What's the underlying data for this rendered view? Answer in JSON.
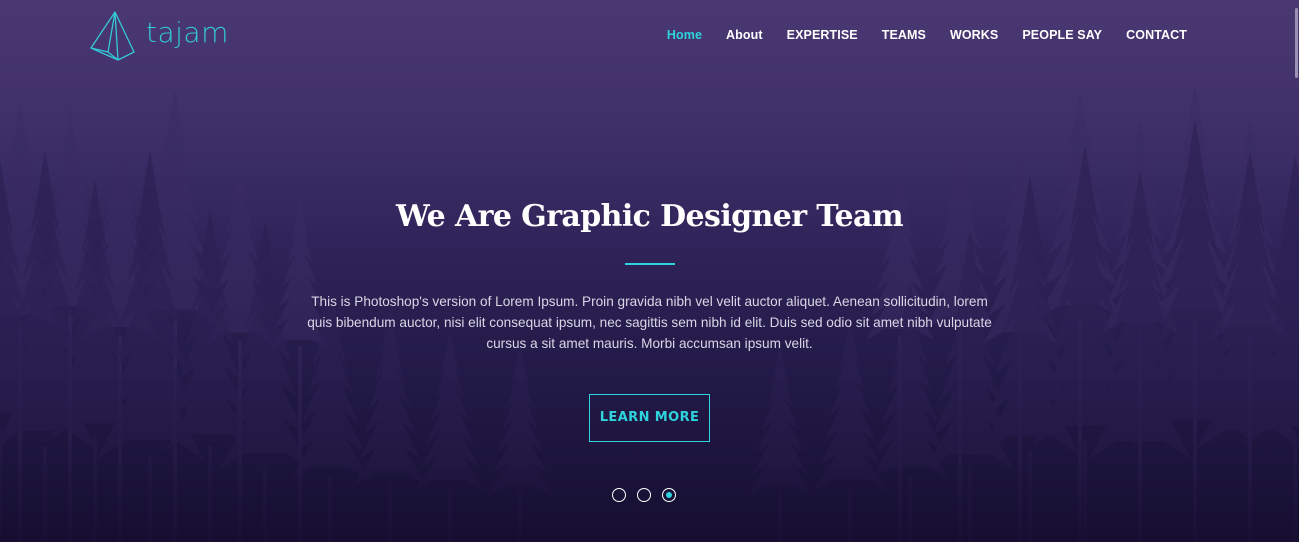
{
  "brand": {
    "name": "tajam",
    "accent_color": "#2ed3dd",
    "logo_icon": "paper-plane-pyramid-icon"
  },
  "nav": {
    "items": [
      {
        "label": "Home",
        "active": true
      },
      {
        "label": "About",
        "active": false
      },
      {
        "label": "EXPERTISE",
        "active": false
      },
      {
        "label": "TEAMS",
        "active": false
      },
      {
        "label": "WORKS",
        "active": false
      },
      {
        "label": "PEOPLE SAY",
        "active": false
      },
      {
        "label": "CONTACT",
        "active": false
      }
    ]
  },
  "hero": {
    "title": "We Are Graphic Designer Team",
    "description": "This is Photoshop's version of Lorem Ipsum. Proin gravida nibh vel velit auctor aliquet. Aenean sollicitudin, lorem quis bibendum auctor, nisi elit consequat ipsum, nec sagittis sem nibh id elit. Duis sed odio sit amet nibh vulputate cursus a sit amet mauris. Morbi accumsan ipsum velit.",
    "cta_label": "LEARN MORE",
    "background": "forest-silhouette"
  },
  "slider": {
    "total": 3,
    "active_index": 2
  }
}
